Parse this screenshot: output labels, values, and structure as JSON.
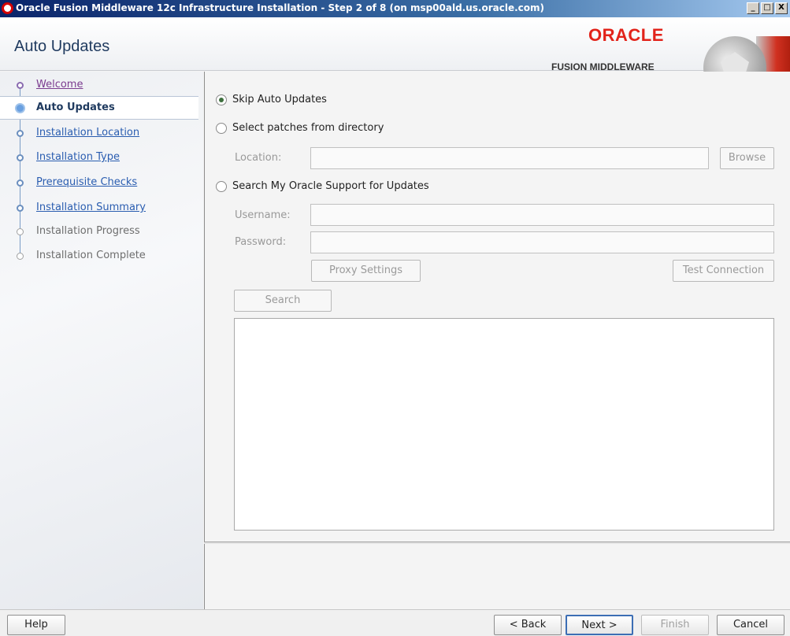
{
  "window": {
    "title": "Oracle Fusion Middleware 12c Infrastructure Installation - Step 2 of 8 (on msp00ald.us.oracle.com)",
    "controls": {
      "minimize": "_",
      "maximize": "□",
      "close": "X"
    }
  },
  "header": {
    "page_title": "Auto Updates",
    "brand_oracle": "ORACLE",
    "brand_tagline": "FUSION MIDDLEWARE",
    "brand_color": "#e2231a"
  },
  "nav": {
    "items": [
      {
        "label": "Welcome",
        "state": "visited"
      },
      {
        "label": "Auto Updates",
        "state": "current"
      },
      {
        "label": "Installation Location",
        "state": "done"
      },
      {
        "label": "Installation Type",
        "state": "done"
      },
      {
        "label": "Prerequisite Checks",
        "state": "done"
      },
      {
        "label": "Installation Summary",
        "state": "done"
      },
      {
        "label": "Installation Progress",
        "state": "future"
      },
      {
        "label": "Installation Complete",
        "state": "future"
      }
    ]
  },
  "options": {
    "skip": {
      "label": "Skip Auto Updates",
      "checked": true
    },
    "directory": {
      "label": "Select patches from directory",
      "checked": false
    },
    "support": {
      "label": "Search My Oracle Support for Updates",
      "checked": false
    }
  },
  "form": {
    "location_label": "Location:",
    "location_value": "",
    "browse_label": "Browse",
    "username_label": "Username:",
    "username_value": "",
    "password_label": "Password:",
    "password_value": "",
    "proxy_label": "Proxy Settings",
    "test_label": "Test Connection",
    "search_label": "Search"
  },
  "footer": {
    "help": "Help",
    "back": "< Back",
    "next": "Next >",
    "finish": "Finish",
    "cancel": "Cancel"
  }
}
